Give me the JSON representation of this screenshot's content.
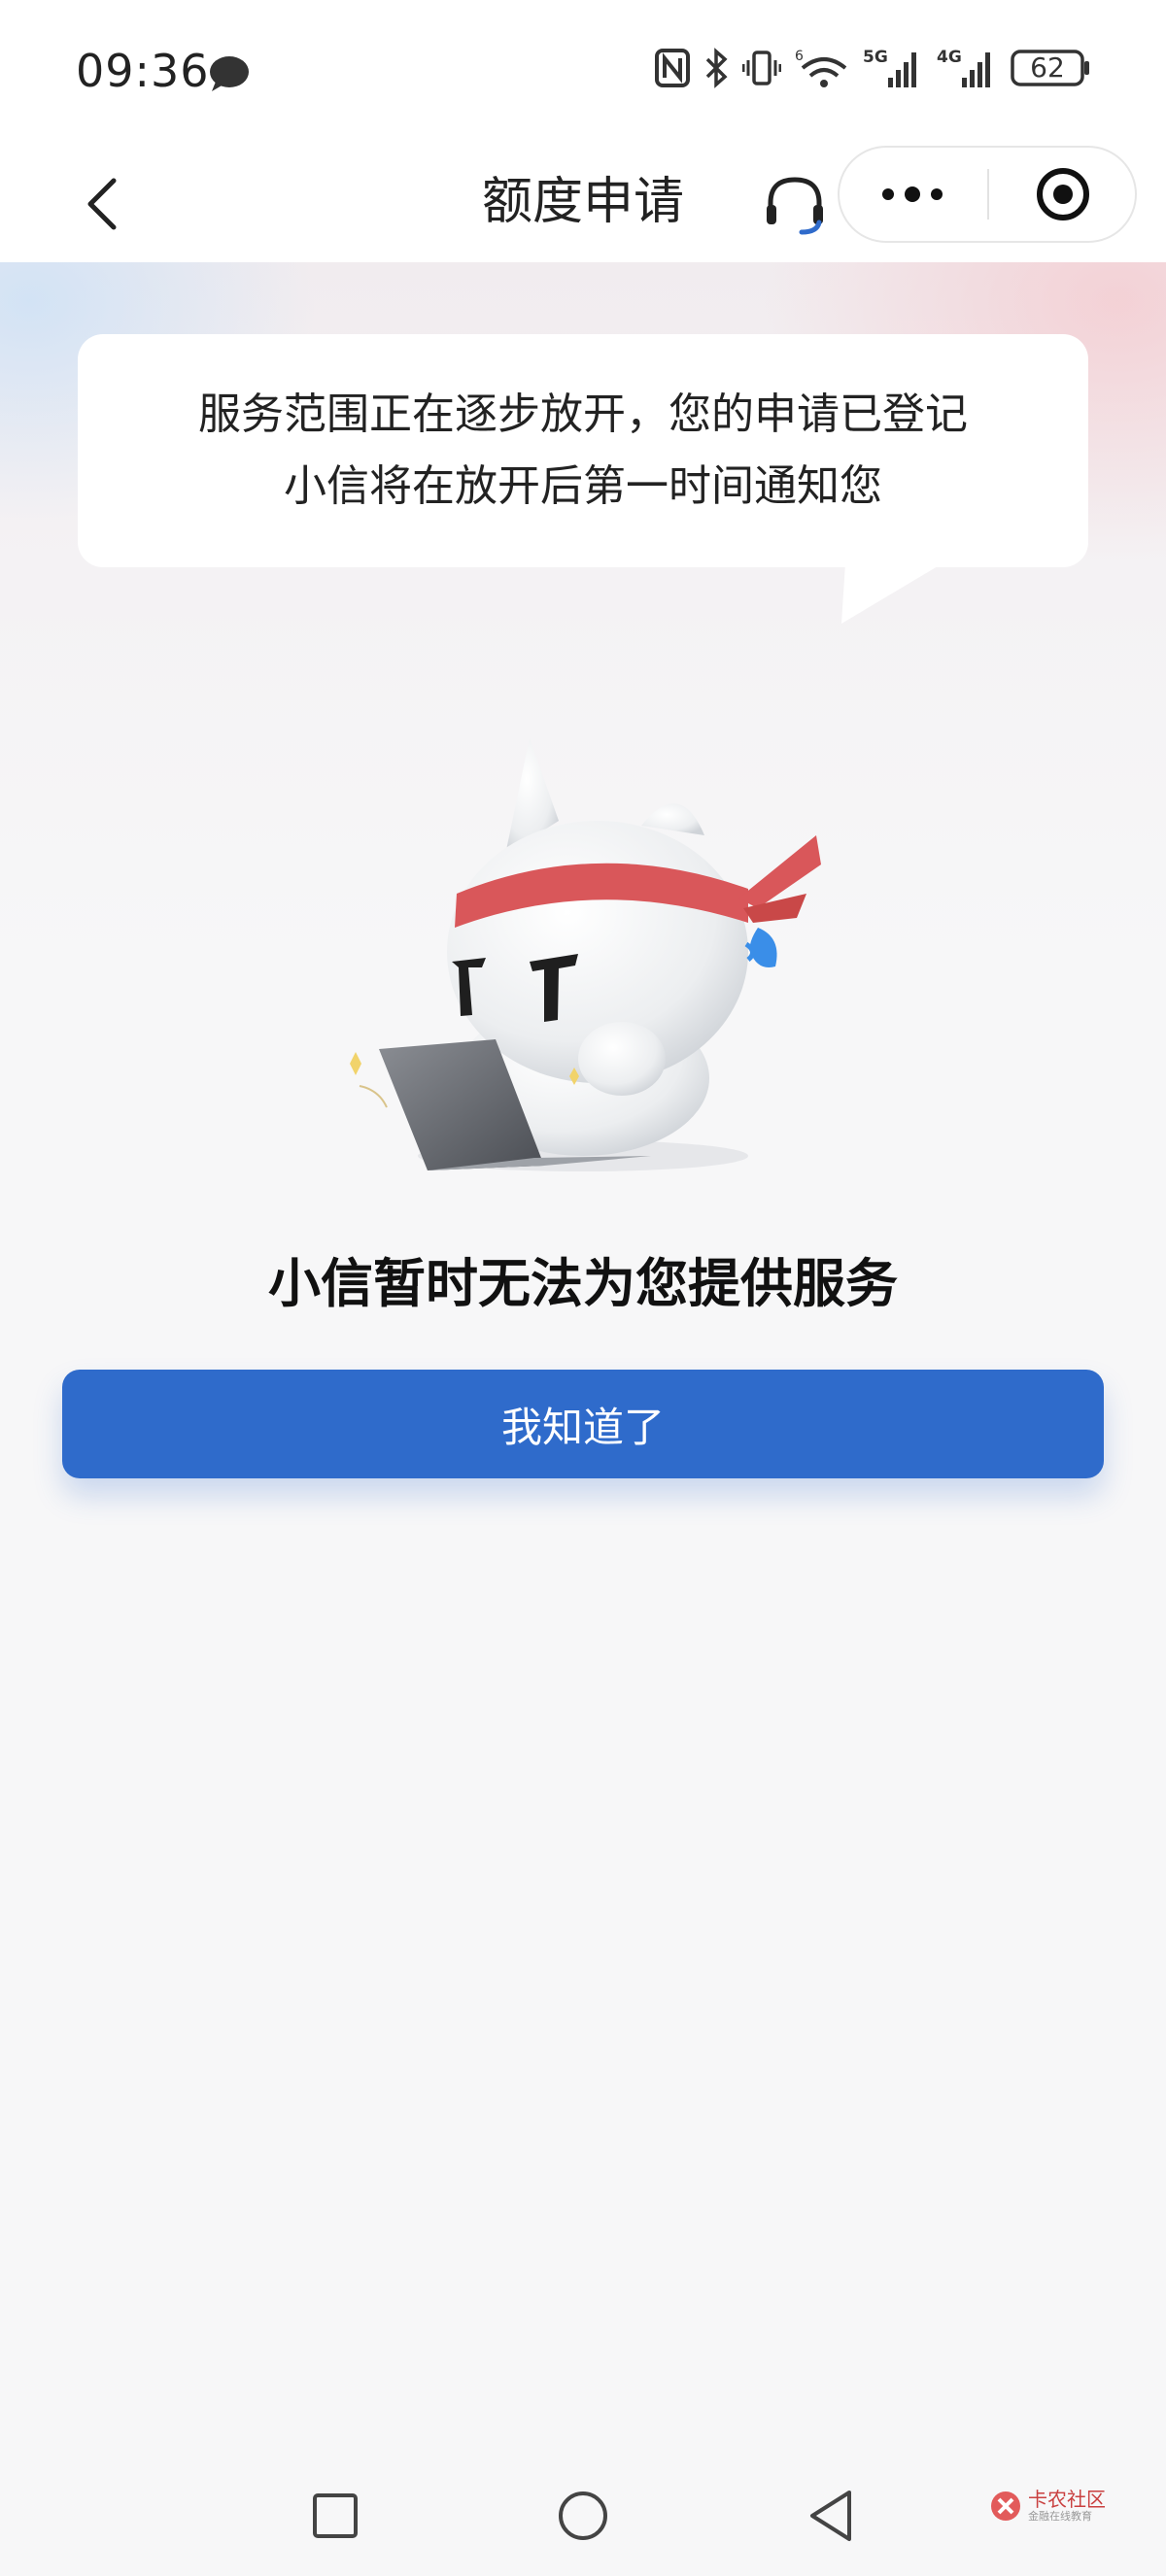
{
  "status_bar": {
    "time": "09:36",
    "battery": "62",
    "network_5g": "5G",
    "network_4g": "4G"
  },
  "nav": {
    "title": "额度申请"
  },
  "bubble": {
    "line1": "服务范围正在逐步放开，您的申请已登记",
    "line2": "小信将在放开后第一时间通知您"
  },
  "result": {
    "title": "小信暂时无法为您提供服务",
    "button_label": "我知道了"
  },
  "watermark": {
    "brand": "卡农社区",
    "sub": "金融在线教育"
  },
  "colors": {
    "primary": "#2f6bcb",
    "headband": "#d9575a",
    "sweat": "#3a8ee8"
  }
}
